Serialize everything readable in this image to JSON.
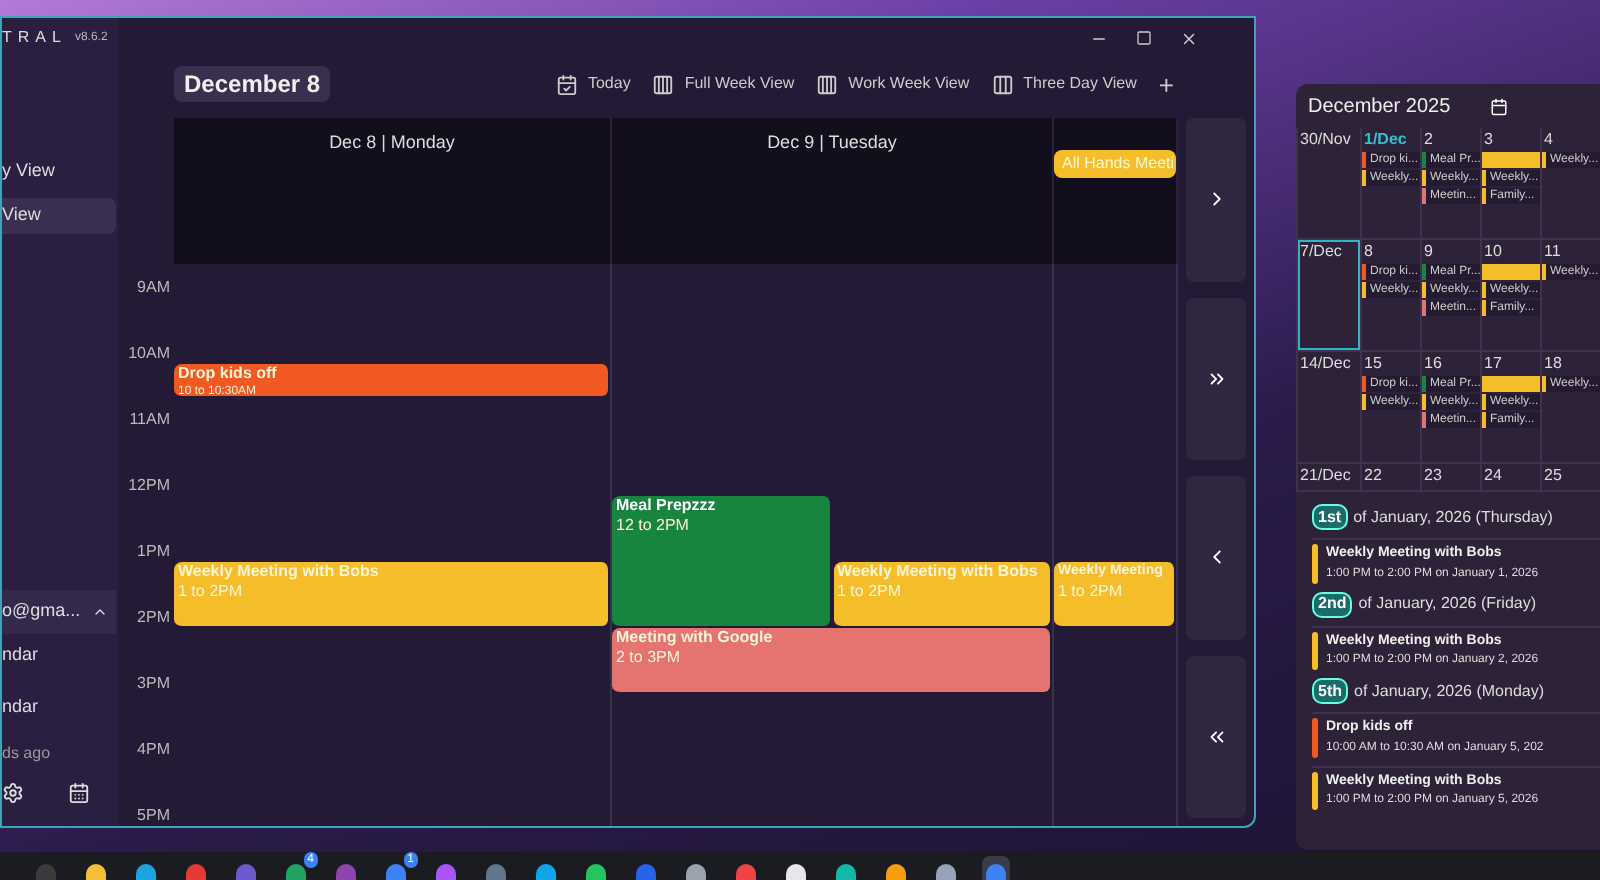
{
  "main_window": {
    "app_title": "TRAL",
    "version": "v8.6.2",
    "sidebar": {
      "items": [
        {
          "label": "y View",
          "selected": false
        },
        {
          "label": "View",
          "selected": true
        }
      ],
      "account": {
        "email": "o@gma...",
        "expanded": true
      },
      "calendars": [
        {
          "label": "ndar"
        },
        {
          "label": "ndar"
        }
      ],
      "sync_status": "ds ago"
    },
    "date_title": "December 8",
    "toolbar": [
      {
        "label": "Today",
        "kind": "today"
      },
      {
        "label": "Full Week View",
        "kind": "week"
      },
      {
        "label": "Work Week View",
        "kind": "week"
      },
      {
        "label": "Three Day View",
        "kind": "three"
      },
      {
        "label": "+",
        "kind": "add"
      }
    ],
    "hours": [
      "9AM",
      "10AM",
      "11AM",
      "12PM",
      "1PM",
      "2PM",
      "3PM",
      "4PM",
      "5PM"
    ],
    "day_columns": [
      {
        "header": "Dec 8 | Monday",
        "events": [
          {
            "title": "Drop kids off",
            "time": "10 to 10:30AM",
            "color": "#f05a22"
          },
          {
            "title": "Weekly Meeting with Bobs",
            "time": "1 to 2PM",
            "color": "#f6bd2b"
          }
        ]
      },
      {
        "header": "Dec 9 | Tuesday",
        "events": [
          {
            "title": "Meal Prepzzz",
            "time": "12 to 2PM",
            "color": "#17843f"
          },
          {
            "title": "Weekly Meeting with Bobs",
            "time": "1 to 2PM",
            "color": "#f6bd2b"
          },
          {
            "title": "Meeting with Google",
            "time": "2 to 3PM",
            "color": "#e5736f"
          }
        ]
      },
      {
        "all_day": [
          {
            "title": "All Hands Meeti",
            "color": "#f6bd2b"
          }
        ],
        "events": [
          {
            "title": "Weekly Meeting",
            "time": "1 to 2PM",
            "color": "#f6bd2b"
          }
        ]
      }
    ]
  },
  "side_panel": {
    "title": "December 2025",
    "weeks": [
      {
        "days": [
          {
            "label": "30/Nov",
            "selected": false,
            "today": false
          },
          {
            "label": "1/Dec",
            "selected": false,
            "today": true,
            "chips": [
              {
                "title": "Drop ki...",
                "color": "#f05a22"
              },
              {
                "title": "Weekly...",
                "color": "#f6bd2b"
              }
            ]
          },
          {
            "label": "2",
            "selected": false,
            "today": false,
            "chips": [
              {
                "title": "Meal Pr...",
                "color": "#17843f"
              },
              {
                "title": "Weekly...",
                "color": "#f6bd2b"
              },
              {
                "title": "Meetin...",
                "color": "#e5736f"
              }
            ]
          },
          {
            "label": "3",
            "selected": false,
            "today": false,
            "chips": [
              {
                "kind": "banner",
                "color": "#f6bd2b"
              },
              {
                "title": "Weekly...",
                "color": "#f6bd2b"
              },
              {
                "title": "Family...",
                "color": "#f6bd2b"
              }
            ]
          },
          {
            "label": "4",
            "selected": false,
            "today": false,
            "chips": [
              {
                "title": "Weekly...",
                "color": "#f6bd2b"
              }
            ]
          }
        ]
      },
      {
        "days": [
          {
            "label": "7/Dec",
            "selected": true,
            "today": false
          },
          {
            "label": "8",
            "selected": false,
            "today": false,
            "chips": [
              {
                "title": "Drop ki...",
                "color": "#f05a22"
              },
              {
                "title": "Weekly...",
                "color": "#f6bd2b"
              }
            ]
          },
          {
            "label": "9",
            "selected": false,
            "today": false,
            "chips": [
              {
                "title": "Meal Pr...",
                "color": "#17843f"
              },
              {
                "title": "Weekly...",
                "color": "#f6bd2b"
              },
              {
                "title": "Meetin...",
                "color": "#e5736f"
              }
            ]
          },
          {
            "label": "10",
            "selected": false,
            "today": false,
            "chips": [
              {
                "kind": "banner",
                "color": "#f6bd2b"
              },
              {
                "title": "Weekly...",
                "color": "#f6bd2b"
              },
              {
                "title": "Family...",
                "color": "#f6bd2b"
              }
            ]
          },
          {
            "label": "11",
            "selected": false,
            "today": false,
            "chips": [
              {
                "title": "Weekly...",
                "color": "#f6bd2b"
              }
            ]
          }
        ]
      },
      {
        "days": [
          {
            "label": "14/Dec",
            "selected": false,
            "today": false
          },
          {
            "label": "15",
            "selected": false,
            "today": false,
            "chips": [
              {
                "title": "Drop ki...",
                "color": "#f05a22"
              },
              {
                "title": "Weekly...",
                "color": "#f6bd2b"
              }
            ]
          },
          {
            "label": "16",
            "selected": false,
            "today": false,
            "chips": [
              {
                "title": "Meal Pr...",
                "color": "#17843f"
              },
              {
                "title": "Weekly...",
                "color": "#f6bd2b"
              },
              {
                "title": "Meetin...",
                "color": "#e5736f"
              }
            ]
          },
          {
            "label": "17",
            "selected": false,
            "today": false,
            "chips": [
              {
                "kind": "banner",
                "color": "#f6bd2b"
              },
              {
                "title": "Weekly...",
                "color": "#f6bd2b"
              },
              {
                "title": "Family...",
                "color": "#f6bd2b"
              }
            ]
          },
          {
            "label": "18",
            "selected": false,
            "today": false,
            "chips": [
              {
                "title": "Weekly...",
                "color": "#f6bd2b"
              }
            ]
          }
        ]
      },
      {
        "days": [
          {
            "label": "21/Dec",
            "selected": false,
            "today": false
          },
          {
            "label": "22",
            "selected": false,
            "today": false
          },
          {
            "label": "23",
            "selected": false,
            "today": false
          },
          {
            "label": "24",
            "selected": false,
            "today": false
          },
          {
            "label": "25",
            "selected": false,
            "today": false
          }
        ]
      }
    ],
    "agenda": [
      {
        "badge": "1st",
        "heading": "of January, 2026 (Thursday)",
        "events": [
          {
            "title": "Weekly Meeting with Bobs",
            "time": "1:00 PM to 2:00 PM on January 1, 2026",
            "color": "#f6bd2b"
          }
        ]
      },
      {
        "badge": "2nd",
        "heading": "of January, 2026 (Friday)",
        "events": [
          {
            "title": "Weekly Meeting with Bobs",
            "time": "1:00 PM to 2:00 PM on January 2, 2026",
            "color": "#f6bd2b"
          }
        ]
      },
      {
        "badge": "5th",
        "heading": "of January, 2026 (Monday)",
        "events": [
          {
            "title": "Drop kids off",
            "time": "10:00 AM to 10:30 AM on January 5, 202",
            "color": "#f05a22"
          },
          {
            "title": "Weekly Meeting with Bobs",
            "time": "1:00 PM to 2:00 PM on January 5, 2026",
            "color": "#f6bd2b"
          }
        ]
      }
    ]
  },
  "taskbar": {
    "apps": [
      {
        "selected": false
      },
      {
        "selected": false
      },
      {
        "selected": false
      },
      {
        "selected": false
      },
      {
        "selected": false
      },
      {
        "selected": false,
        "badge": "4"
      },
      {
        "selected": false
      },
      {
        "selected": false,
        "badge": "1"
      },
      {
        "selected": false
      },
      {
        "selected": false
      },
      {
        "selected": false
      },
      {
        "selected": false
      },
      {
        "selected": false
      },
      {
        "selected": false
      },
      {
        "selected": false
      },
      {
        "selected": false
      },
      {
        "selected": false
      },
      {
        "selected": false
      },
      {
        "selected": false
      },
      {
        "selected": true
      }
    ]
  }
}
